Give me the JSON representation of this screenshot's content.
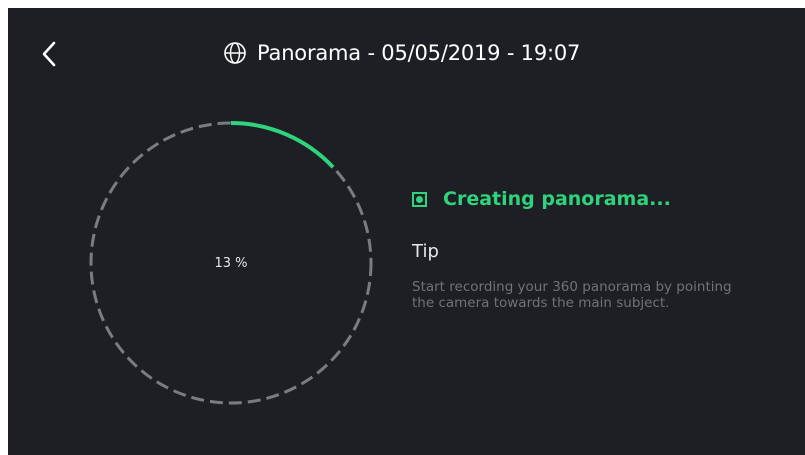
{
  "header": {
    "back_icon": "chevron-left-icon",
    "title_icon": "globe-icon",
    "title": "Panorama - 05/05/2019 - 19:07"
  },
  "progress": {
    "value": 0.13,
    "label": "13 %",
    "fill_color": "#2fd37c",
    "track_color": "#7a7c80"
  },
  "status": {
    "icon": "record-indicator-icon",
    "text": "Creating panorama...",
    "color": "#2fd37c"
  },
  "tip": {
    "heading": "Tip",
    "body": "Start recording your 360 panorama by pointing the camera towards the main subject."
  }
}
